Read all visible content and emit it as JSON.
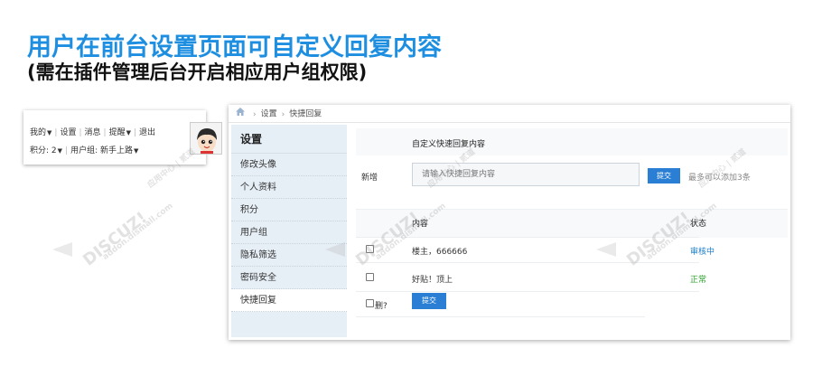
{
  "heading": {
    "title": "用户在前台设置页面可自定义回复内容",
    "subtitle": "(需在插件管理后台开启相应用户组权限)"
  },
  "userbar": {
    "my": "我的",
    "settings": "设置",
    "messages": "消息",
    "reminders": "提醒",
    "logout": "退出",
    "points": "积分: 2",
    "usergroup": "用户组: 新手上路"
  },
  "breadcrumb": {
    "items": [
      "设置",
      "快捷回复"
    ]
  },
  "sidebar": {
    "heading": "设置",
    "items": [
      {
        "label": "修改头像"
      },
      {
        "label": "个人资料"
      },
      {
        "label": "积分"
      },
      {
        "label": "用户组"
      },
      {
        "label": "隐私筛选"
      },
      {
        "label": "密码安全"
      },
      {
        "label": "快捷回复",
        "active": true
      }
    ]
  },
  "content": {
    "title": "自定义快速回复内容",
    "new_label": "新增",
    "input_placeholder": "请输入快捷回复内容",
    "submit_label": "提交",
    "hint": "最多可以添加3条",
    "col_content": "内容",
    "col_status": "状态",
    "rows": [
      {
        "text": "楼主，666666",
        "status": "审核中"
      },
      {
        "text": "好贴！顶上",
        "status": "正常"
      }
    ],
    "delete_label": "删?",
    "submit2_label": "提交"
  },
  "watermark": {
    "brand": "DISCUZ!",
    "cn": "应用中心 | 贰道",
    "site": "addon.dismall.com"
  },
  "colors": {
    "accent": "#1e8fe0",
    "button": "#2a7fd4",
    "status_review": "#1e7ec8",
    "status_ok": "#2ea12e",
    "sidebar_bg": "#e6eef6"
  }
}
